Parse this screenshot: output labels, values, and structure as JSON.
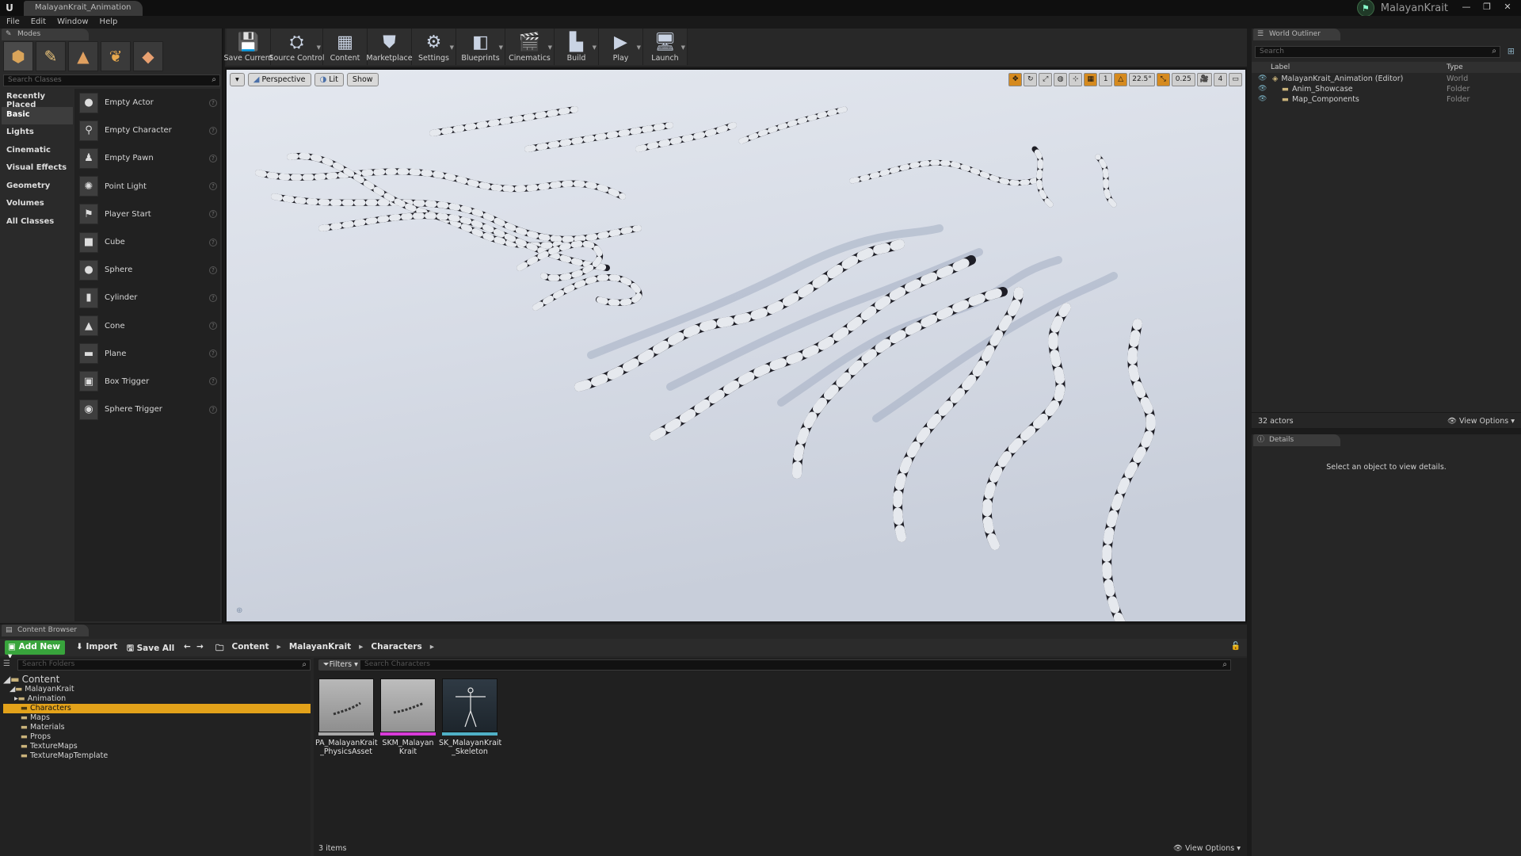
{
  "window": {
    "tab_title": "MalayanKrait_Animation",
    "project_name": "MalayanKrait",
    "controls": [
      "—",
      "❐",
      "✕"
    ]
  },
  "menu": [
    "File",
    "Edit",
    "Window",
    "Help"
  ],
  "modes": {
    "tab_label": "Modes",
    "search_placeholder": "Search Classes",
    "categories": [
      "Recently Placed",
      "Basic",
      "Lights",
      "Cinematic",
      "Visual Effects",
      "Geometry",
      "Volumes",
      "All Classes"
    ],
    "selected_category": "Basic",
    "classes": [
      "Empty Actor",
      "Empty Character",
      "Empty Pawn",
      "Point Light",
      "Player Start",
      "Cube",
      "Sphere",
      "Cylinder",
      "Cone",
      "Plane",
      "Box Trigger",
      "Sphere Trigger"
    ]
  },
  "toolbar": {
    "buttons": [
      {
        "label": "Save Current",
        "icon": "save-icon"
      },
      {
        "label": "Source Control",
        "icon": "source-control-icon"
      },
      {
        "label": "Content",
        "icon": "content-icon"
      },
      {
        "label": "Marketplace",
        "icon": "marketplace-icon"
      },
      {
        "label": "Settings",
        "icon": "settings-icon"
      },
      {
        "label": "Blueprints",
        "icon": "blueprints-icon"
      },
      {
        "label": "Cinematics",
        "icon": "cinematics-icon"
      },
      {
        "label": "Build",
        "icon": "build-icon"
      },
      {
        "label": "Play",
        "icon": "play-icon"
      },
      {
        "label": "Launch",
        "icon": "launch-icon"
      }
    ]
  },
  "viewport": {
    "view_mode": "Perspective",
    "lighting": "Lit",
    "show_label": "Show",
    "snap_rotation": "22.5°",
    "snap_scale": "0.25",
    "camera_speed": "4",
    "grid_value": "1"
  },
  "outliner": {
    "tab_label": "World Outliner",
    "search_placeholder": "Search",
    "col_label": "Label",
    "col_type": "Type",
    "rows": [
      {
        "name": "MalayanKrait_Animation (Editor)",
        "type": "World"
      },
      {
        "name": "Anim_Showcase",
        "type": "Folder"
      },
      {
        "name": "Map_Components",
        "type": "Folder"
      }
    ],
    "actor_count": "32 actors",
    "view_options": "View Options"
  },
  "details": {
    "tab_label": "Details",
    "empty_message": "Select an object to view details."
  },
  "content_browser": {
    "tab_label": "Content Browser",
    "add_new": "Add New",
    "import": "Import",
    "save_all": "Save All",
    "breadcrumb": [
      "Content",
      "MalayanKrait",
      "Characters"
    ],
    "folder_search_placeholder": "Search Folders",
    "filters_label": "Filters",
    "asset_search_placeholder": "Search Characters",
    "tree": [
      {
        "name": "Content",
        "depth": 0
      },
      {
        "name": "MalayanKrait",
        "depth": 1
      },
      {
        "name": "Animation",
        "depth": 2
      },
      {
        "name": "Characters",
        "depth": 2
      },
      {
        "name": "Maps",
        "depth": 2
      },
      {
        "name": "Materials",
        "depth": 2
      },
      {
        "name": "Props",
        "depth": 2
      },
      {
        "name": "TextureMaps",
        "depth": 2
      },
      {
        "name": "TextureMapTemplate",
        "depth": 2
      }
    ],
    "selected_folder": "Characters",
    "assets": [
      {
        "name_line1": "PA_MalayanKrait",
        "name_line2": "_PhysicsAsset",
        "color": "#a8a8a8"
      },
      {
        "name_line1": "SKM_Malayan",
        "name_line2": "Krait",
        "color": "#d93bd9"
      },
      {
        "name_line1": "SK_MalayanKrait",
        "name_line2": "_Skeleton",
        "color": "#4fb0c6"
      }
    ],
    "item_count": "3 items",
    "view_options": "View Options"
  },
  "colors": {
    "accent_orange": "#e3a21a",
    "add_new_green": "#38a43c"
  }
}
